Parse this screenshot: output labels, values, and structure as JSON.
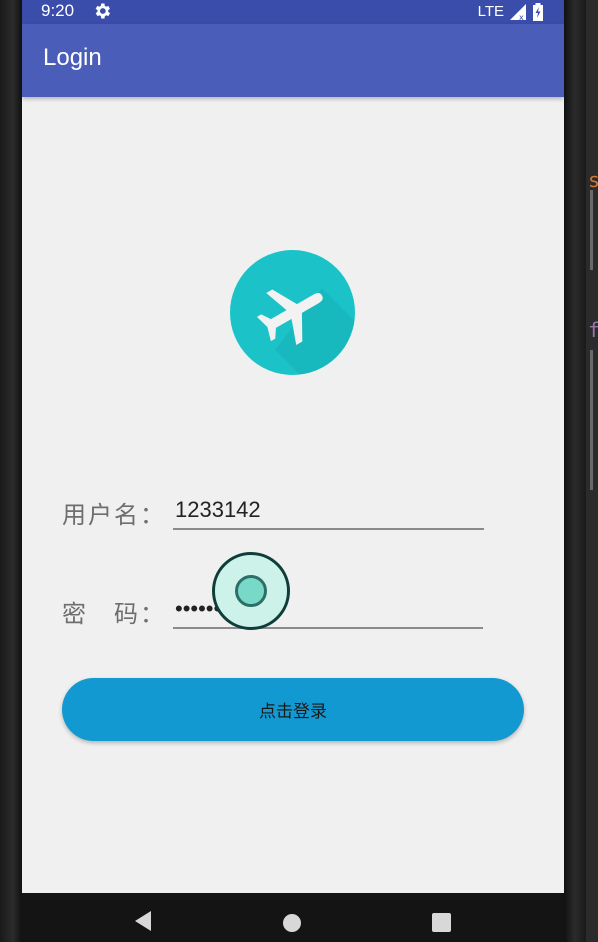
{
  "status_bar": {
    "time": "9:20",
    "network": "LTE",
    "icons": [
      "gear-icon",
      "signal-icon",
      "battery-icon"
    ]
  },
  "app_bar": {
    "title": "Login"
  },
  "logo": {
    "icon": "airplane-icon",
    "color": "#1bc3c9"
  },
  "form": {
    "username_label": "用户名：",
    "username_value": "1233142",
    "password_label": "密　码：",
    "password_value": "•••••••"
  },
  "login_button": {
    "label": "点击登录",
    "color": "#1399d2"
  },
  "nav_bar": {
    "icons": [
      "back-icon",
      "home-icon",
      "recents-icon"
    ]
  },
  "colors": {
    "status_bar": "#3b4daa",
    "app_bar": "#4a5db8",
    "background": "#f0f0f0"
  }
}
